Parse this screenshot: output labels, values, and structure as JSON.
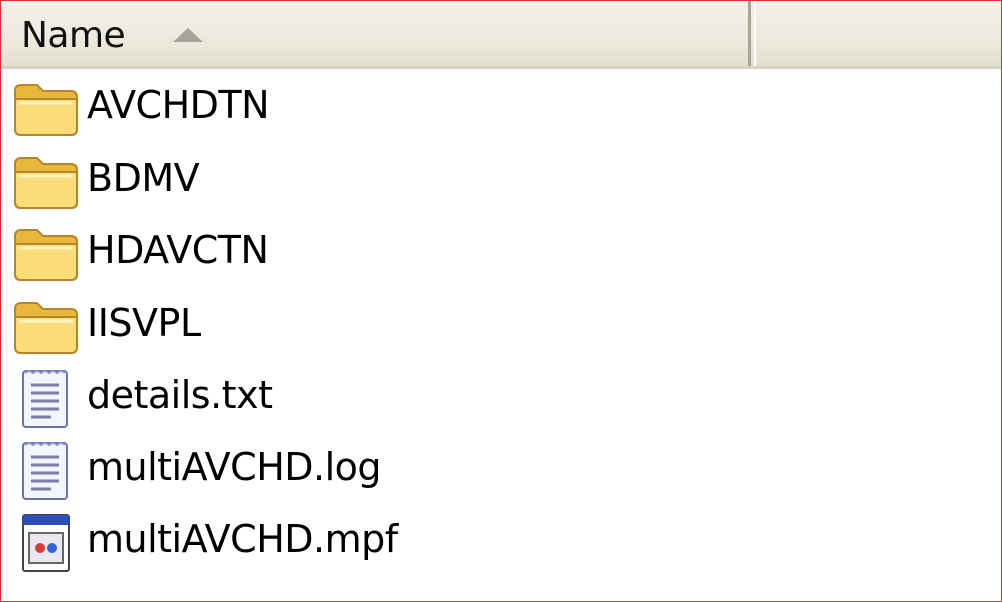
{
  "header": {
    "name_column": "Name",
    "sort_direction": "ascending"
  },
  "files": [
    {
      "name": "AVCHDTN",
      "icon": "folder-icon"
    },
    {
      "name": "BDMV",
      "icon": "folder-icon"
    },
    {
      "name": "HDAVCTN",
      "icon": "folder-icon"
    },
    {
      "name": "IISVPL",
      "icon": "folder-icon"
    },
    {
      "name": "details.txt",
      "icon": "text-file-icon"
    },
    {
      "name": "multiAVCHD.log",
      "icon": "text-file-icon"
    },
    {
      "name": "multiAVCHD.mpf",
      "icon": "app-file-icon"
    }
  ]
}
